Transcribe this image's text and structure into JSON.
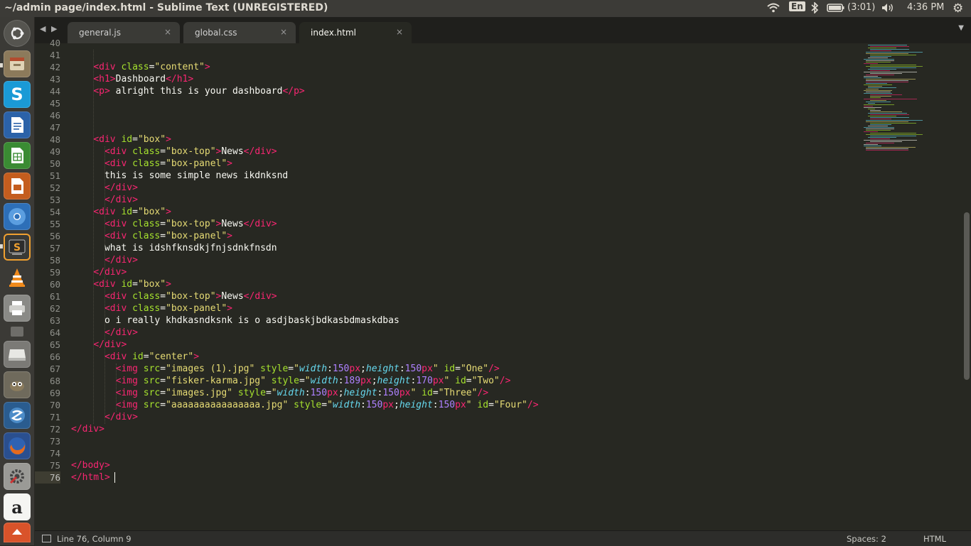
{
  "window": {
    "title": "~/admin page/index.html - Sublime Text (UNREGISTERED)"
  },
  "topbar": {
    "keyboard": "En",
    "battery": "(3:01)",
    "clock": "4:36 PM",
    "icons": [
      "wifi-icon",
      "keyboard-layout-icon",
      "bluetooth-icon",
      "battery-icon",
      "volume-icon",
      "power-gear-icon"
    ]
  },
  "launcher": {
    "items": [
      "ubuntu-dash",
      "files",
      "skype",
      "libreoffice-writer",
      "libreoffice-calc",
      "libreoffice-impress",
      "chromium",
      "sublime-text",
      "vlc",
      "printer",
      "drive",
      "removable-drive",
      "gimp",
      "disk-utility",
      "firefox",
      "system-settings",
      "amazon",
      "software-updater"
    ]
  },
  "tabs": [
    {
      "label": "general.js",
      "close": "×"
    },
    {
      "label": "global.css",
      "close": "×"
    },
    {
      "label": "index.html",
      "close": "×"
    }
  ],
  "editor": {
    "first_partial_line": "40",
    "lines": [
      {
        "n": "41",
        "html": ""
      },
      {
        "n": "42",
        "html": "    <span class=\"tg\">&lt;div</span> <span class=\"at\">class</span>=<span class=\"st\">\"content\"</span><span class=\"tg\">&gt;</span>"
      },
      {
        "n": "43",
        "html": "    <span class=\"tg\">&lt;</span><span class=\"tg\">h1</span><span class=\"tg\">&gt;</span>Dashboard<span class=\"tg\">&lt;/</span><span class=\"tg\">h1</span><span class=\"tg\">&gt;</span>"
      },
      {
        "n": "44",
        "html": "    <span class=\"tg\">&lt;</span><span class=\"tg\">p</span><span class=\"tg\">&gt;</span> alright this is your dashboard<span class=\"tg\">&lt;/</span><span class=\"tg\">p</span><span class=\"tg\">&gt;</span>"
      },
      {
        "n": "45",
        "html": ""
      },
      {
        "n": "46",
        "html": ""
      },
      {
        "n": "47",
        "html": ""
      },
      {
        "n": "48",
        "html": "    <span class=\"tg\">&lt;div</span> <span class=\"at\">id</span>=<span class=\"st\">\"box\"</span><span class=\"tg\">&gt;</span>"
      },
      {
        "n": "49",
        "html": "      <span class=\"tg\">&lt;div</span> <span class=\"at\">class</span>=<span class=\"st\">\"box-top\"</span><span class=\"tg\">&gt;</span>News<span class=\"tg\">&lt;/div&gt;</span>"
      },
      {
        "n": "50",
        "html": "      <span class=\"tg\">&lt;div</span> <span class=\"at\">class</span>=<span class=\"st\">\"box-panel\"</span><span class=\"tg\">&gt;</span>"
      },
      {
        "n": "51",
        "html": "      this is some simple news ikdnksnd"
      },
      {
        "n": "52",
        "html": "      <span class=\"tg\">&lt;/div&gt;</span>"
      },
      {
        "n": "53",
        "html": "      <span class=\"tg\">&lt;/div&gt;</span>"
      },
      {
        "n": "54",
        "html": "    <span class=\"tg\">&lt;div</span> <span class=\"at\">id</span>=<span class=\"st\">\"box\"</span><span class=\"tg\">&gt;</span>"
      },
      {
        "n": "55",
        "html": "      <span class=\"tg\">&lt;div</span> <span class=\"at\">class</span>=<span class=\"st\">\"box-top\"</span><span class=\"tg\">&gt;</span>News<span class=\"tg\">&lt;/div&gt;</span>"
      },
      {
        "n": "56",
        "html": "      <span class=\"tg\">&lt;div</span> <span class=\"at\">class</span>=<span class=\"st\">\"box-panel\"</span><span class=\"tg\">&gt;</span>"
      },
      {
        "n": "57",
        "html": "      what is idshfknsdkjfnjsdnkfnsdn"
      },
      {
        "n": "58",
        "html": "      <span class=\"tg\">&lt;/div&gt;</span>"
      },
      {
        "n": "59",
        "html": "    <span class=\"tg\">&lt;/div&gt;</span>"
      },
      {
        "n": "60",
        "html": "    <span class=\"tg\">&lt;div</span> <span class=\"at\">id</span>=<span class=\"st\">\"box\"</span><span class=\"tg\">&gt;</span>"
      },
      {
        "n": "61",
        "html": "      <span class=\"tg\">&lt;div</span> <span class=\"at\">class</span>=<span class=\"st\">\"box-top\"</span><span class=\"tg\">&gt;</span>News<span class=\"tg\">&lt;/div&gt;</span>"
      },
      {
        "n": "62",
        "html": "      <span class=\"tg\">&lt;div</span> <span class=\"at\">class</span>=<span class=\"st\">\"box-panel\"</span><span class=\"tg\">&gt;</span>"
      },
      {
        "n": "63",
        "html": "      o i really khdkasndksnk is o asdjbaskjbdkasbdmaskdbas"
      },
      {
        "n": "64",
        "html": "      <span class=\"tg\">&lt;/div&gt;</span>"
      },
      {
        "n": "65",
        "html": "    <span class=\"tg\">&lt;/div&gt;</span>"
      },
      {
        "n": "66",
        "html": "      <span class=\"tg\">&lt;div</span> <span class=\"at\">id</span>=<span class=\"st\">\"center\"</span><span class=\"tg\">&gt;</span>"
      },
      {
        "n": "67",
        "html": "        <span class=\"tg\">&lt;img</span> <span class=\"at\">src</span>=<span class=\"st\">\"images (1).jpg\"</span> <span class=\"at\">style</span>=<span class=\"st\">\"</span><span class=\"pr\">width</span>:<span class=\"nm\">150</span><span class=\"tg\">px</span>;<span class=\"pr\">height</span>:<span class=\"nm\">150</span><span class=\"tg\">px</span><span class=\"st\">\"</span> <span class=\"at\">id</span>=<span class=\"st\">\"One\"</span><span class=\"tg\">/&gt;</span>"
      },
      {
        "n": "68",
        "html": "        <span class=\"tg\">&lt;img</span> <span class=\"at\">src</span>=<span class=\"st\">\"fisker-karma.jpg\"</span> <span class=\"at\">style</span>=<span class=\"st\">\"</span><span class=\"pr\">width</span>:<span class=\"nm\">189</span><span class=\"tg\">px</span>;<span class=\"pr\">height</span>:<span class=\"nm\">170</span><span class=\"tg\">px</span><span class=\"st\">\"</span> <span class=\"at\">id</span>=<span class=\"st\">\"Two\"</span><span class=\"tg\">/&gt;</span>"
      },
      {
        "n": "69",
        "html": "        <span class=\"tg\">&lt;img</span> <span class=\"at\">src</span>=<span class=\"st\">\"images.jpg\"</span> <span class=\"at\">style</span>=<span class=\"st\">\"</span><span class=\"pr\">width</span>:<span class=\"nm\">150</span><span class=\"tg\">px</span>;<span class=\"pr\">height</span>:<span class=\"nm\">150</span><span class=\"tg\">px</span><span class=\"st\">\"</span> <span class=\"at\">id</span>=<span class=\"st\">\"Three\"</span><span class=\"tg\">/&gt;</span>"
      },
      {
        "n": "70",
        "html": "        <span class=\"tg\">&lt;img</span> <span class=\"at\">src</span>=<span class=\"st\">\"aaaaaaaaaaaaaaaa.jpg\"</span> <span class=\"at\">style</span>=<span class=\"st\">\"</span><span class=\"pr\">width</span>:<span class=\"nm\">150</span><span class=\"tg\">px</span>;<span class=\"pr\">height</span>:<span class=\"nm\">150</span><span class=\"tg\">px</span><span class=\"st\">\"</span> <span class=\"at\">id</span>=<span class=\"st\">\"Four\"</span><span class=\"tg\">/&gt;</span>"
      },
      {
        "n": "71",
        "html": "      <span class=\"tg\">&lt;/div&gt;</span>"
      },
      {
        "n": "72",
        "html": "<span class=\"tg\">&lt;/div&gt;</span>"
      },
      {
        "n": "73",
        "html": ""
      },
      {
        "n": "74",
        "html": ""
      },
      {
        "n": "75",
        "html": "<span class=\"tg\">&lt;/</span><span class=\"tg\">body</span><span class=\"tg\">&gt;</span>"
      },
      {
        "n": "76",
        "html": "<span class=\"tg\">&lt;/</span><span class=\"tg\">html</span><span class=\"tg\">&gt;</span>"
      }
    ],
    "current_line": "76"
  },
  "statusbar": {
    "position": "Line 76, Column 9",
    "spaces": "Spaces: 2",
    "syntax": "HTML"
  },
  "colors": {
    "background": "#272822",
    "tag": "#f92672",
    "attribute": "#a6e22e",
    "string": "#e6db74",
    "property": "#66d9ef",
    "number": "#ae81ff",
    "text": "#f8f8f2"
  }
}
